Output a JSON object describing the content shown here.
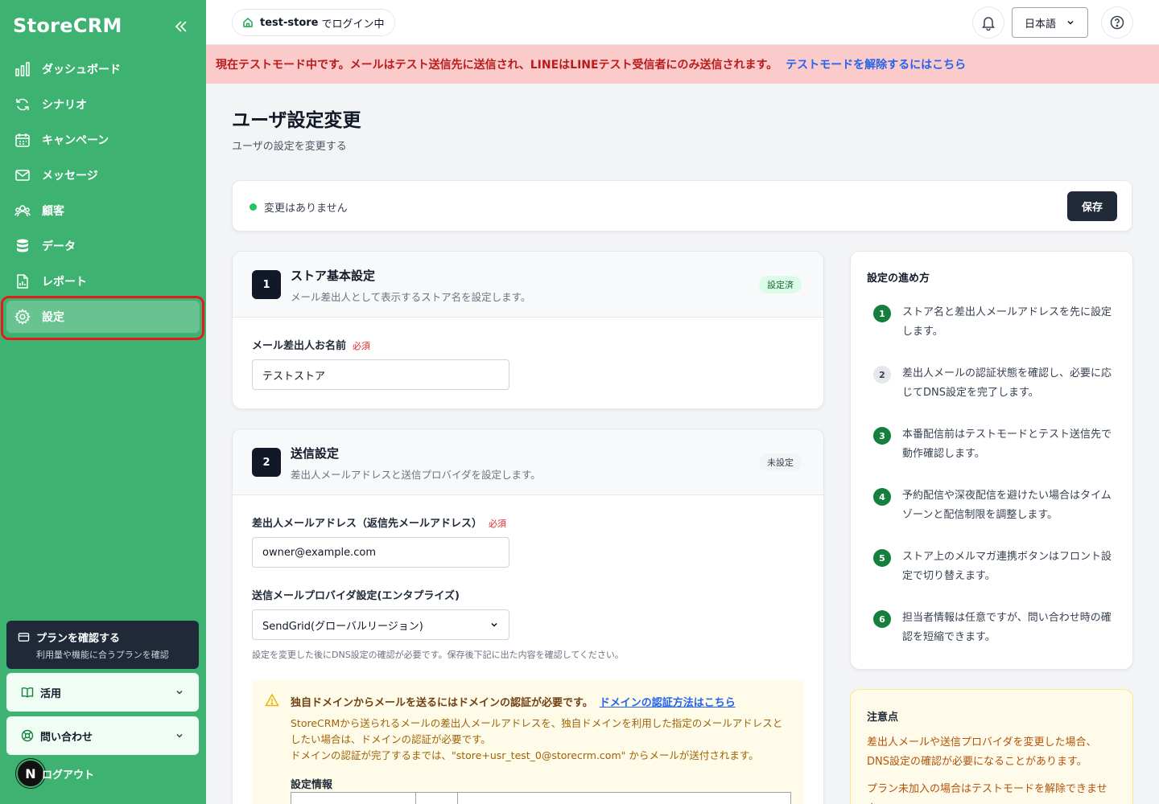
{
  "sidebar": {
    "logo": "StoreCRM",
    "items": [
      {
        "label": "ダッシュボード",
        "icon": "chart-bars-icon"
      },
      {
        "label": "シナリオ",
        "icon": "refresh-icon"
      },
      {
        "label": "キャンペーン",
        "icon": "calendar-icon"
      },
      {
        "label": "メッセージ",
        "icon": "mail-icon"
      },
      {
        "label": "顧客",
        "icon": "users-icon"
      },
      {
        "label": "データ",
        "icon": "database-icon"
      },
      {
        "label": "レポート",
        "icon": "report-icon"
      },
      {
        "label": "設定",
        "icon": "gear-icon",
        "active": true
      }
    ],
    "plan": {
      "title": "プランを確認する",
      "subtitle": "利用量や機能に合うプランを確認"
    },
    "usage": "活用",
    "contact": "問い合わせ",
    "logout": "ログアウト",
    "avatar_letter": "N"
  },
  "topbar": {
    "store_name": "test-store",
    "store_suffix": "でログイン中",
    "language": "日本語"
  },
  "banner": {
    "text": "現在テストモード中です。メールはテスト送信先に送信され、LINEはLINEテスト受信者にのみ送信されます。",
    "link": "テストモードを解除するにはこちら"
  },
  "page": {
    "title": "ユーザ設定変更",
    "subtitle": "ユーザの設定を変更する"
  },
  "status": {
    "text": "変更はありません",
    "save_label": "保存"
  },
  "section1": {
    "number": "1",
    "title": "ストア基本設定",
    "description": "メール差出人として表示するストア名を設定します。",
    "badge": "設定済",
    "sender_name_label": "メール差出人お名前",
    "required": "必須",
    "sender_name_value": "テストストア"
  },
  "section2": {
    "number": "2",
    "title": "送信設定",
    "description": "差出人メールアドレスと送信プロバイダを設定します。",
    "badge": "未設定",
    "email_label": "差出人メールアドレス（返信先メールアドレス）",
    "required": "必須",
    "email_value": "owner@example.com",
    "provider_label": "送信メールプロバイダ設定(エンタプライズ)",
    "provider_value": "SendGrid(グローバルリージョン)",
    "hint": "設定を変更した後にDNS設定の確認が必要です。保存後下記に出た内容を確認してください。",
    "warning": {
      "title": "独自ドメインからメールを送るにはドメインの認証が必要です。",
      "link": "ドメインの認証方法はこちら",
      "body1": "StoreCRMから送られるメールの差出人メールアドレスを、独自ドメインを利用した指定のメールアドレスとしたい場合は、ドメインの認証が必要です。",
      "body2": "ドメインの認証が完了するまでは、\"store+usr_test_0@storecrm.com\" からメールが送付されます。",
      "settings_label": "設定情報"
    }
  },
  "guide": {
    "title": "設定の進め方",
    "steps": [
      {
        "n": "1",
        "text": "ストア名と差出人メールアドレスを先に設定します。"
      },
      {
        "n": "2",
        "text": "差出人メールの認証状態を確認し、必要に応じてDNS設定を完了します。"
      },
      {
        "n": "3",
        "text": "本番配信前はテストモードとテスト送信先で動作確認します。"
      },
      {
        "n": "4",
        "text": "予約配信や深夜配信を避けたい場合はタイムゾーンと配信制限を調整します。"
      },
      {
        "n": "5",
        "text": "ストア上のメルマガ連携ボタンはフロント設定で切り替えます。"
      },
      {
        "n": "6",
        "text": "担当者情報は任意ですが、問い合わせ時の確認を短縮できます。"
      }
    ]
  },
  "notes": {
    "title": "注意点",
    "items": [
      "差出人メールや送信プロバイダを変更した場合、DNS設定の確認が必要になることがあります。",
      "プラン未加入の場合はテストモードを解除できません。"
    ]
  },
  "colors": {
    "sidebar": "#3eb371",
    "primary_dark": "#1f2937",
    "danger": "#dc2626",
    "link": "#2563eb"
  }
}
